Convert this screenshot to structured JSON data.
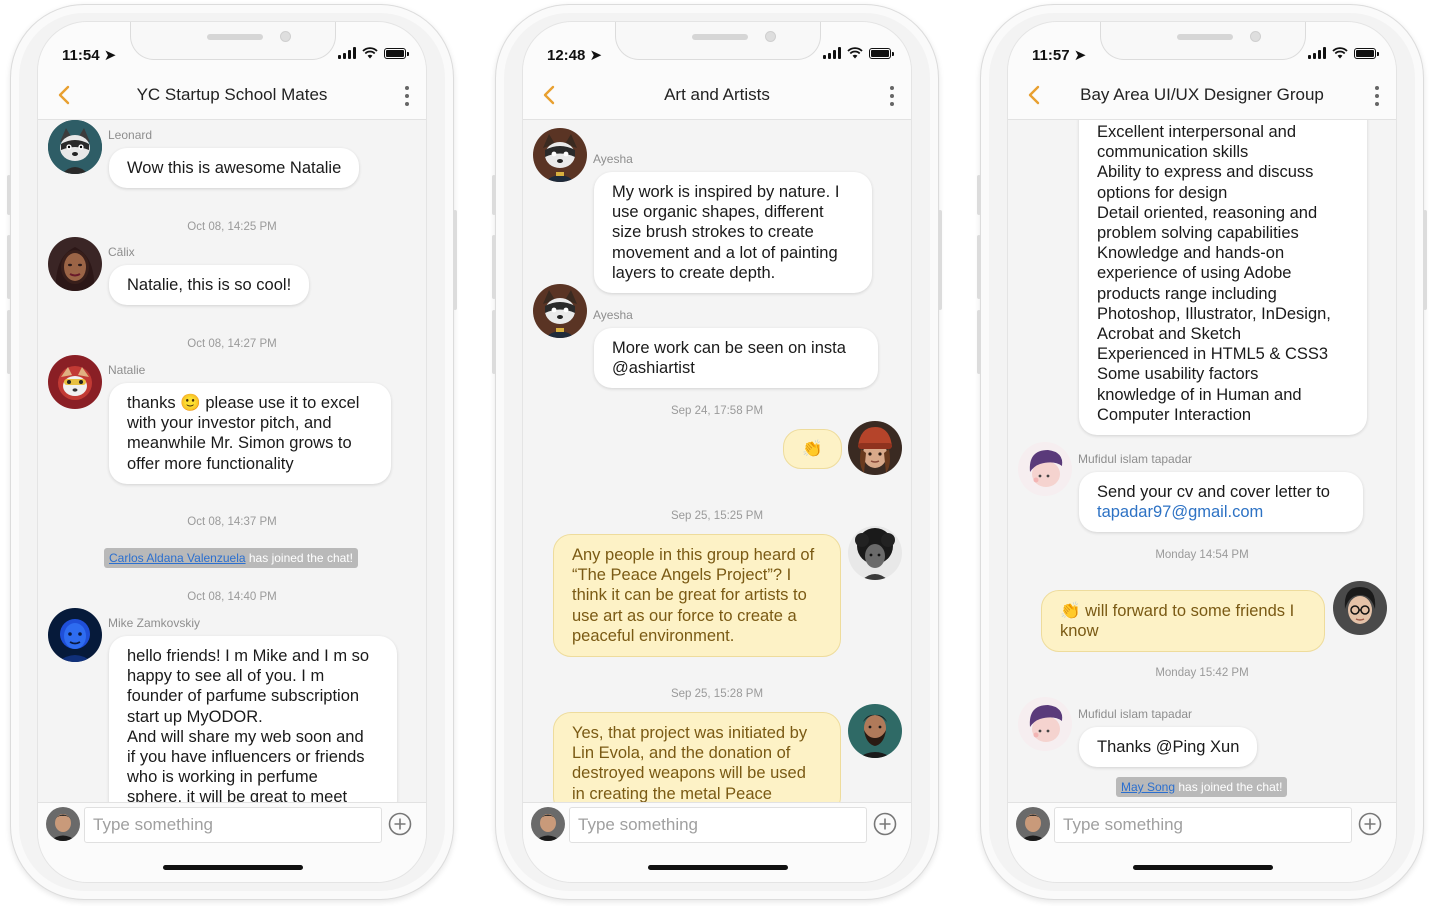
{
  "colors": {
    "accent": "#e8a030",
    "own_bubble": "#fdf2c6",
    "own_text": "#7a5a14",
    "link": "#2d72c4"
  },
  "icons": {
    "back": "chevron-left-icon",
    "more": "more-vertical-icon",
    "add": "plus-circle-icon",
    "location": "location-arrow-icon"
  },
  "phones": [
    {
      "status": {
        "time": "11:54"
      },
      "title": "YC Startup School Mates",
      "input_placeholder": "Type something",
      "messages": [
        {
          "sender": "Leonard",
          "lines": [
            "Wow this is awesome Natalie"
          ]
        },
        {
          "stamp": "Oct 08, 14:25 PM"
        },
        {
          "sender": "Cālix",
          "lines": [
            "Natalie, this is so cool!"
          ]
        },
        {
          "stamp": "Oct 08, 14:27 PM"
        },
        {
          "sender": "Natalie",
          "lines": [
            "thanks 🙂 please use it to excel",
            "with your investor pitch, and",
            "meanwhile Mr. Simon grows to",
            "offer more functionality"
          ]
        },
        {
          "stamp": "Oct 08, 14:37 PM"
        },
        {
          "join_name": "Carlos Aldana Valenzuela",
          "join_text": " has joined the chat!"
        },
        {
          "stamp": "Oct 08, 14:40 PM"
        },
        {
          "sender": "Mike Zamkovskiy",
          "lines": [
            "hello friends! I m Mike and I m so",
            "happy to see all of you. I m",
            "founder of parfume subscription",
            "start up MyODOR.",
            "And will share my web soon and",
            "if you have influencers or friends",
            "who is working in perfume",
            "sphere, it will be great to meet"
          ]
        }
      ]
    },
    {
      "status": {
        "time": "12:48"
      },
      "title": "Art and Artists",
      "input_placeholder": "Type something",
      "messages": [
        {
          "sender": "Ayesha",
          "lines": [
            "My work is inspired by nature. I",
            "use organic shapes, different",
            "size brush strokes to create",
            "movement and a lot of painting",
            "layers to create depth."
          ]
        },
        {
          "sender": "Ayesha",
          "lines": [
            "More work can be seen on insta",
            "@ashiartist"
          ]
        },
        {
          "stamp": "Sep 24, 17:58 PM"
        },
        {
          "own": true,
          "lines": [
            "👏"
          ]
        },
        {
          "stamp": "Sep 25, 15:25 PM"
        },
        {
          "own": true,
          "lines": [
            "Any people in this group heard of",
            "“The Peace Angels Project”? I",
            "think it can be great for artists to",
            "use art as our force to create a",
            "peaceful environment."
          ]
        },
        {
          "stamp": "Sep 25, 15:28 PM"
        },
        {
          "own": true,
          "lines": [
            "Yes, that project was initiated by",
            "Lin Evola, and the donation of",
            "destroyed weapons will be used",
            "in creating the metal Peace"
          ]
        }
      ]
    },
    {
      "status": {
        "time": "11:57"
      },
      "title": "Bay Area UI/UX Designer Group",
      "input_placeholder": "Type something",
      "messages": [
        {
          "lines": [
            "Excellent interpersonal and",
            "communication skills",
            "Ability to express and discuss",
            "options for design",
            "Detail oriented, reasoning and",
            "problem solving capabilities",
            "Knowledge and hands-on",
            "experience of using Adobe",
            "products range including",
            "Photoshop, Illustrator, InDesign,",
            "Acrobat and Sketch",
            "Experienced in HTML5 & CSS3",
            "Some usability factors",
            "knowledge of in Human and",
            "Computer Interaction"
          ]
        },
        {
          "sender": "Mufidul islam tapadar",
          "lines": [
            "Send your cv and cover letter to"
          ],
          "link": "tapadar97@gmail.com"
        },
        {
          "stamp": "Monday 14:54 PM"
        },
        {
          "own": true,
          "lines": [
            "👏 will forward to some friends I",
            "know"
          ]
        },
        {
          "stamp": "Monday 15:42 PM"
        },
        {
          "sender": "Mufidul islam tapadar",
          "lines": [
            "Thanks @Ping Xun"
          ]
        },
        {
          "join_name": "May Song",
          "join_text": " has joined the chat!"
        }
      ]
    }
  ]
}
